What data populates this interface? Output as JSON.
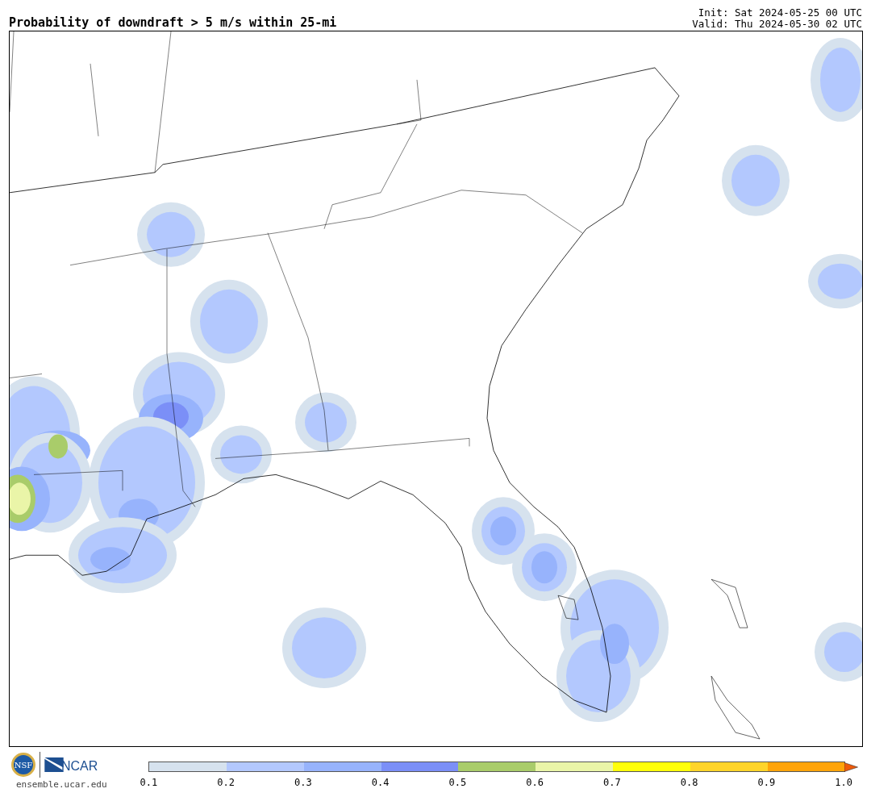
{
  "header": {
    "title": "Probability of downdraft > 5 m/s within 25-mi",
    "init": "Init: Sat 2024-05-25 00 UTC",
    "valid": "Valid: Thu 2024-05-30 02 UTC"
  },
  "colorbar": {
    "bins": [
      {
        "color": "#d6e2ee"
      },
      {
        "color": "#b3c8fe"
      },
      {
        "color": "#97b3fc"
      },
      {
        "color": "#7b8ff7"
      },
      {
        "color": "#a9cc6a"
      },
      {
        "color": "#eaf5a8"
      },
      {
        "color": "#ffff0a"
      },
      {
        "color": "#ffd42a"
      },
      {
        "color": "#ffa40a"
      }
    ],
    "ticks": [
      "0.1",
      "0.2",
      "0.3",
      "0.4",
      "0.5",
      "0.6",
      "0.7",
      "0.8",
      "0.9",
      "1.0"
    ]
  },
  "footer": {
    "nsf_logo": "NSF",
    "ncar_logo": "NCAR",
    "url": "ensemble.ucar.edu"
  }
}
